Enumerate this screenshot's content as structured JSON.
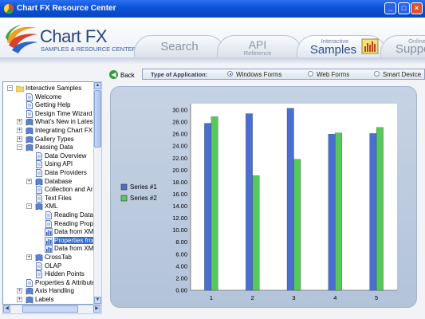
{
  "window": {
    "title": "Chart FX Resource Center",
    "controls": {
      "minimize": "_",
      "maximize": "□",
      "close": "×"
    }
  },
  "header": {
    "logo_main": "Chart FX",
    "logo_sub": "SAMPLES & RESOURCE CENTER",
    "tabs": [
      {
        "label": "Search",
        "sub": ""
      },
      {
        "label": "API",
        "sub": "Reference"
      },
      {
        "label": "Samples",
        "sub": "Interactive"
      },
      {
        "label": "Suppo",
        "sub": "Online"
      }
    ]
  },
  "tree": {
    "items": [
      {
        "label": "Interactive Samples",
        "icon": "folder-icon"
      },
      {
        "label": "Welcome",
        "icon": "page-icon"
      },
      {
        "label": "Getting Help",
        "icon": "page-icon"
      },
      {
        "label": "Design Time Wizard",
        "icon": "page-icon"
      },
      {
        "label": "What's New in Latest",
        "icon": "book-icon"
      },
      {
        "label": "Integrating Chart FX",
        "icon": "book-icon"
      },
      {
        "label": "Gallery Types",
        "icon": "book-icon"
      },
      {
        "label": "Passing Data",
        "icon": "book-icon"
      },
      {
        "label": "Data Overview",
        "icon": "page-icon"
      },
      {
        "label": "Using API",
        "icon": "page-icon"
      },
      {
        "label": "Data Providers",
        "icon": "page-icon"
      },
      {
        "label": "Database",
        "icon": "book-icon"
      },
      {
        "label": "Collection and Arr",
        "icon": "page-icon"
      },
      {
        "label": "Text Files",
        "icon": "page-icon"
      },
      {
        "label": "XML",
        "icon": "book-icon"
      },
      {
        "label": "Reading Data",
        "icon": "page-icon"
      },
      {
        "label": "Reading Prop",
        "icon": "page-icon"
      },
      {
        "label": "Data from XM",
        "icon": "chart-icon"
      },
      {
        "label": "Properties fror",
        "icon": "chart-icon"
      },
      {
        "label": "Data from XM",
        "icon": "chart-icon"
      },
      {
        "label": "CrossTab",
        "icon": "book-icon"
      },
      {
        "label": "OLAP",
        "icon": "page-icon"
      },
      {
        "label": "Hidden Points",
        "icon": "page-icon"
      },
      {
        "label": "Properties & Attributes",
        "icon": "page-icon"
      },
      {
        "label": "Axis Handling",
        "icon": "book-icon"
      },
      {
        "label": "Labels",
        "icon": "book-icon"
      }
    ]
  },
  "toolbar": {
    "back_label": "Back",
    "app_type_label": "Type of Application:",
    "options": [
      "Windows Forms",
      "Web Forms",
      "Smart Device"
    ],
    "selected": "Windows Forms"
  },
  "colors": {
    "series1": "#4a6fd1",
    "series2": "#58c85a"
  },
  "chart_data": {
    "type": "bar",
    "categories": [
      "1",
      "2",
      "3",
      "4",
      "5"
    ],
    "series": [
      {
        "name": "Series #1",
        "values": [
          27.8,
          29.4,
          30.3,
          26.0,
          26.1
        ]
      },
      {
        "name": "Series #2",
        "values": [
          28.9,
          19.1,
          21.8,
          26.2,
          27.1
        ]
      }
    ],
    "ylim": [
      0,
      30
    ],
    "yticks": [
      "0.00",
      "2.00",
      "4.00",
      "6.00",
      "8.00",
      "10.00",
      "12.00",
      "14.00",
      "16.00",
      "18.00",
      "20.00",
      "22.00",
      "24.00",
      "26.00",
      "28.00",
      "30.00"
    ],
    "legend": "left",
    "grid": false,
    "title": "",
    "xlabel": "",
    "ylabel": ""
  }
}
